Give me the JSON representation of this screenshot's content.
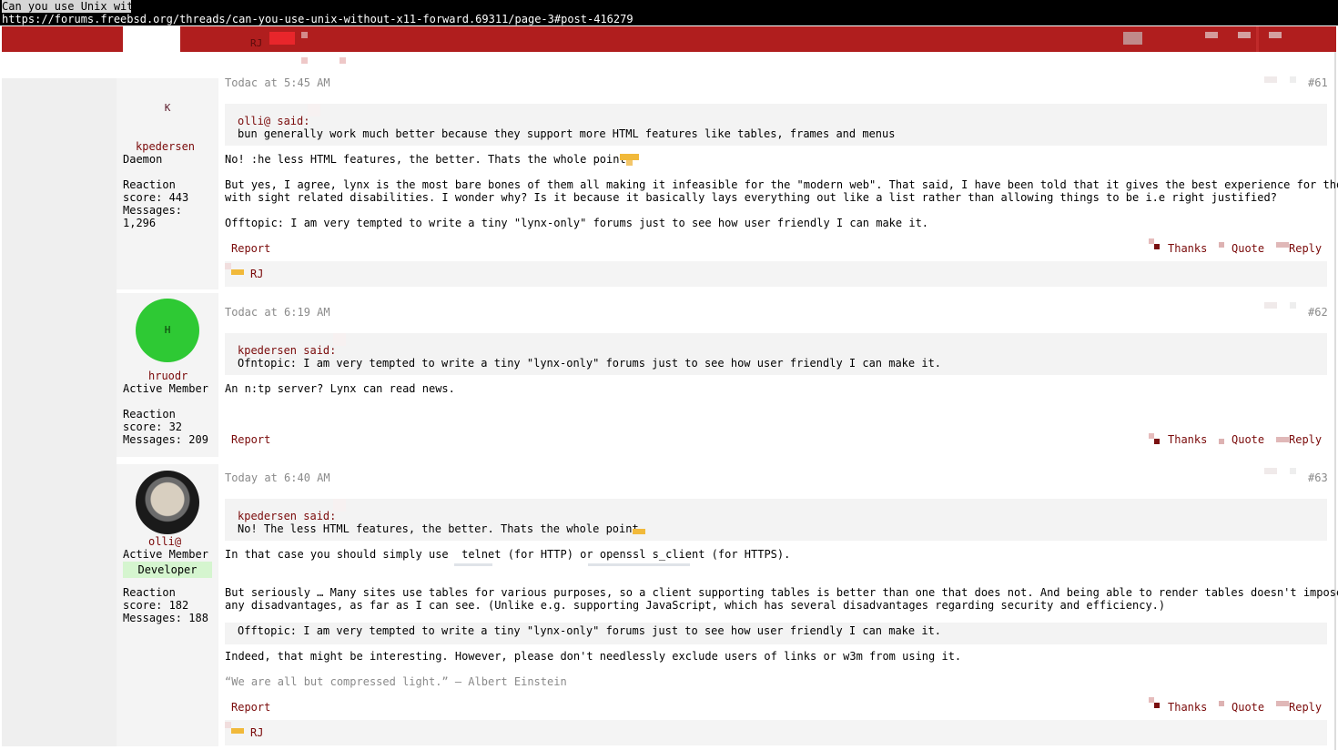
{
  "browser": {
    "title_input": "Can you use Unix wit",
    "url": "https://forums.freebsd.org/threads/can-you-use-unix-without-x11-forward.69311/page-3#post-416279"
  },
  "nav": {
    "user_initials": "RJ"
  },
  "posts": [
    {
      "user": {
        "initial": "K",
        "name": "kpedersen",
        "title": "Daemon",
        "stats": "Reaction\nscore: 443\nMessages:\n1,296",
        "avatar_color": "#e48aaa"
      },
      "time": "Todac at 5:45 AM",
      "number": "#61",
      "quote": {
        "author": "olli@ said:",
        "text": "bun generally work much better because they support more HTML features like tables, frames and menus"
      },
      "paragraphs": [
        "No! :he less HTML features, the better. Thats the whole point",
        "But yes, I agree, lynx is the most bare bones of them all making it infeasible for the \"modern web\". That said, I have been told that it gives the best experience for those\nwith sight related disabilities. I wonder why? Is it because it basically lays everything out like a list rather than allowing things to be i.e right justified?",
        "Offtopic: I am very tempted to write a tiny \"lynx-only\" forums just to see how user friendly I can make it."
      ],
      "reactions_by": "RJ"
    },
    {
      "user": {
        "initial": "H",
        "name": "hruodr",
        "title": "Active Member",
        "stats": "Reaction\nscore: 32\nMessages: 209",
        "avatar_color": "#2ec934"
      },
      "time": "Todac at 6:19 AM",
      "number": "#62",
      "quote": {
        "author": "kpedersen said:",
        "text": "Ofntopic: I am very tempted to write a tiny \"lynx-only\" forums just to see how user friendly I can make it."
      },
      "paragraphs": [
        "An n:tp server? Lynx can read news."
      ]
    },
    {
      "user": {
        "name": "olli@",
        "title": "Active Member",
        "badge": "Developer",
        "stats": "Reaction\nscore: 182\nMessages: 188"
      },
      "time": "Today at 6:40 AM",
      "number": "#63",
      "quote": {
        "author": "kpedersen said:",
        "text": "No! The less HTML features, the better. Thats the whole point"
      },
      "p1": {
        "before": "In that case you should simply use ",
        "code1": "telnet",
        "mid": " (for HTTP) or ",
        "code2": "openssl s_client",
        "after": " (for HTTPS)."
      },
      "p2": "But seriously … Many sites use tables for various purposes, so a client supporting tables is better than one that does not. And being able to render tables doesn't impose\nany disadvantages, as far as I can see. (Unlike e.g. supporting JavaScript, which has several disadvantages regarding security and efficiency.)",
      "inline_quote": "Offtopic: I am very tempted to write a tiny \"lynx-only\" forums just to see how user friendly I can make it.",
      "p3": "Indeed, that might be interesting. However, please don't needlessly exclude users of links or w3m from using it.",
      "signature": "“We are all but compressed light.” – Albert Einstein",
      "reactions_by": "RJ"
    }
  ],
  "actions": {
    "report": "Report",
    "thanks": "Thanks",
    "quote": "Quote",
    "reply": "Reply"
  },
  "colors": {
    "nav_red": "#b01e1e",
    "link_red": "#7a0a0a",
    "emoji_yellow": "#f1b93a",
    "badge_green": "#d5f5cf"
  }
}
